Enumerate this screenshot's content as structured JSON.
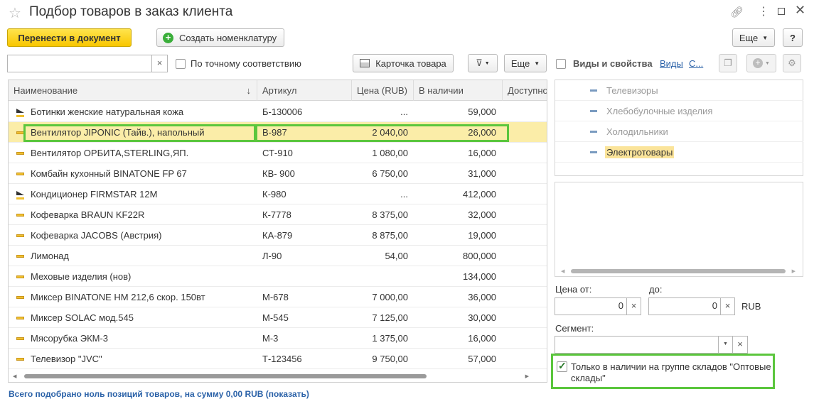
{
  "window": {
    "title": "Подбор товаров в заказ клиента"
  },
  "toolbar": {
    "transfer_label": "Перенести в документ",
    "create_label": "Создать номенклатуру",
    "more_label": "Еще",
    "help_label": "?"
  },
  "search": {
    "value": "",
    "clear": "×",
    "exact_match_label": "По точному соответствию",
    "card_label": "Карточка товара",
    "more_label": "Еще"
  },
  "columns": [
    "Наименование",
    "Артикул",
    "Цена (RUB)",
    "В наличии",
    "Доступно"
  ],
  "sort_arrow": "↓",
  "rows": [
    {
      "name": "Ботинки женские натуральная кожа",
      "article": "Б-130006",
      "price": "...",
      "stock": "59,000",
      "icon": "tri"
    },
    {
      "name": "Вентилятор JIPONIC (Тайв.), напольный",
      "article": "В-987",
      "price": "2 040,00",
      "stock": "26,000",
      "icon": "item"
    },
    {
      "name": "Вентилятор ОРБИТА,STERLING,ЯП.",
      "article": "СТ-910",
      "price": "1 080,00",
      "stock": "16,000",
      "icon": "item"
    },
    {
      "name": "Комбайн кухонный BINATONE FP 67",
      "article": "КВ- 900",
      "price": "6 750,00",
      "stock": "31,000",
      "icon": "item"
    },
    {
      "name": "Кондиционер FIRMSTAR 12M",
      "article": "К-980",
      "price": "...",
      "stock": "412,000",
      "icon": "tri"
    },
    {
      "name": "Кофеварка BRAUN KF22R",
      "article": "К-7778",
      "price": "8 375,00",
      "stock": "32,000",
      "icon": "item"
    },
    {
      "name": "Кофеварка JACOBS (Австрия)",
      "article": "КА-879",
      "price": "8 875,00",
      "stock": "19,000",
      "icon": "item"
    },
    {
      "name": "Лимонад",
      "article": "Л-90",
      "price": "54,00",
      "stock": "800,000",
      "icon": "item"
    },
    {
      "name": "Меховые изделия (нов)",
      "article": "",
      "price": "",
      "stock": "134,000",
      "icon": "item"
    },
    {
      "name": "Миксер BINATONE HM 212,6 скор. 150вт",
      "article": "М-678",
      "price": "7 000,00",
      "stock": "36,000",
      "icon": "item"
    },
    {
      "name": "Миксер SOLAC мод.545",
      "article": "М-545",
      "price": "7 125,00",
      "stock": "30,000",
      "icon": "item"
    },
    {
      "name": "Мясорубка ЭКМ-3",
      "article": "М-3",
      "price": "1 375,00",
      "stock": "16,000",
      "icon": "item"
    },
    {
      "name": "Телевизор \"JVC\"",
      "article": "Т-123456",
      "price": "9 750,00",
      "stock": "57,000",
      "icon": "item"
    }
  ],
  "selected_row": 1,
  "sidebar": {
    "title": "Виды и свойства",
    "link_views": "Виды",
    "link_c": "С...",
    "groups": [
      "Телевизоры",
      "Хлебобулочные изделия",
      "Холодильники",
      "Электротовары"
    ],
    "selected_group": 3
  },
  "filters": {
    "price_from_label": "Цена от:",
    "price_to_label": "до:",
    "price_from": "0",
    "price_to": "0",
    "currency": "RUB",
    "segment_label": "Сегмент:",
    "segment_value": "",
    "only_in_stock_label_1": "Только в наличии на группе складов \"Оптовые",
    "only_in_stock_label_2": "склады\"",
    "only_in_stock_checked": true
  },
  "footer": {
    "summary": "Всего подобрано ноль позиций товаров, на сумму 0,00 RUB (показать)"
  },
  "colors": {
    "accent_yellow": "#f8c600",
    "selection": "#fbeda8",
    "highlight_green": "#5bc63d",
    "link_blue": "#2b62a8"
  }
}
